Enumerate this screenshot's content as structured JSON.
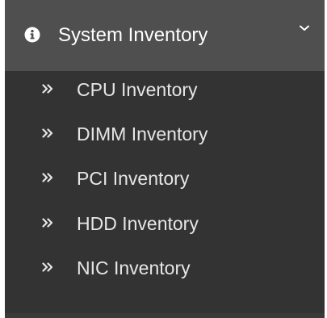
{
  "sidebar": {
    "header": {
      "label": "System Inventory",
      "icon": "info-circle-icon",
      "expanded": true
    },
    "items": [
      {
        "label": "CPU Inventory",
        "icon": "double-chevron-right-icon"
      },
      {
        "label": "DIMM Inventory",
        "icon": "double-chevron-right-icon"
      },
      {
        "label": "PCI Inventory",
        "icon": "double-chevron-right-icon"
      },
      {
        "label": "HDD Inventory",
        "icon": "double-chevron-right-icon"
      },
      {
        "label": "NIC Inventory",
        "icon": "double-chevron-right-icon"
      }
    ]
  },
  "colors": {
    "header_bg": "#4f4f4f",
    "menu_bg": "#333333",
    "header_text": "#ffffff",
    "item_text": "#e6e6e6"
  }
}
